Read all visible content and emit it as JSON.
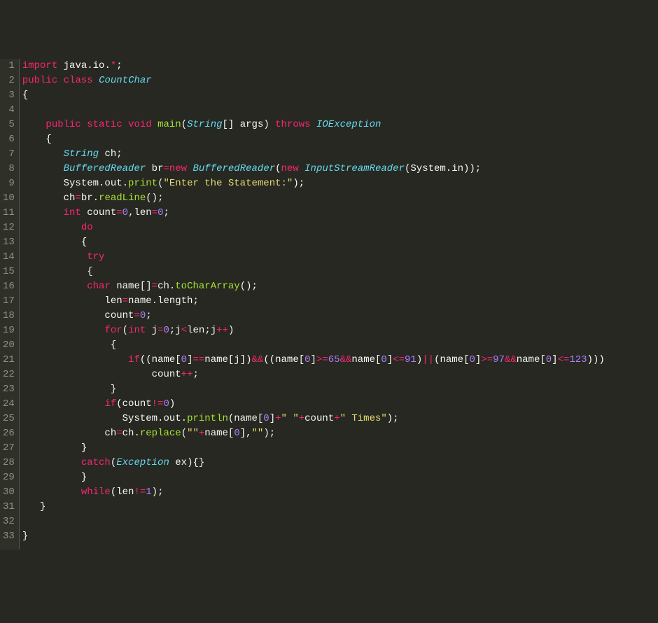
{
  "theme": {
    "background": "#272822",
    "gutter_bg": "#2f3129",
    "gutter_fg": "#8f908a",
    "text": "#f8f8f2",
    "keyword": "#f92672",
    "type": "#66d9ef",
    "function": "#a6e22e",
    "string": "#e6db74",
    "number": "#ae81ff",
    "operator": "#f92672"
  },
  "language": "java",
  "line_count": 33,
  "source_lines": [
    "import java.io.*;",
    "public class CountChar",
    "{",
    "",
    "    public static void main(String[] args) throws IOException",
    "    {",
    "       String ch;",
    "       BufferedReader br=new BufferedReader(new InputStreamReader(System.in));",
    "       System.out.print(\"Enter the Statement:\");",
    "       ch=br.readLine();",
    "       int count=0,len=0;",
    "          do",
    "          {",
    "           try",
    "           {",
    "           char name[]=ch.toCharArray();",
    "              len=name.length;",
    "              count=0;",
    "              for(int j=0;j<len;j++)",
    "               {",
    "                  if((name[0]==name[j])&&((name[0]>=65&&name[0]<=91)||(name[0]>=97&&name[0]<=123)))",
    "                      count++;",
    "               }",
    "              if(count!=0)",
    "                 System.out.println(name[0]+\" \"+count+\" Times\");",
    "              ch=ch.replace(\"\"+name[0],\"\");",
    "          }",
    "          catch(Exception ex){}",
    "          }",
    "          while(len!=1);",
    "   }",
    "",
    "}"
  ],
  "tokens": [
    [
      [
        "kw",
        "import"
      ],
      [
        "plain",
        " java.io."
      ],
      [
        "op",
        "*"
      ],
      [
        "plain",
        ";"
      ]
    ],
    [
      [
        "kw",
        "public"
      ],
      [
        "plain",
        " "
      ],
      [
        "kw",
        "class"
      ],
      [
        "plain",
        " "
      ],
      [
        "type",
        "CountChar"
      ]
    ],
    [
      [
        "plain",
        "{"
      ]
    ],
    [
      [
        "plain",
        ""
      ]
    ],
    [
      [
        "plain",
        "    "
      ],
      [
        "kw",
        "public"
      ],
      [
        "plain",
        " "
      ],
      [
        "kw",
        "static"
      ],
      [
        "plain",
        " "
      ],
      [
        "kw",
        "void"
      ],
      [
        "plain",
        " "
      ],
      [
        "fn",
        "main"
      ],
      [
        "plain",
        "("
      ],
      [
        "type",
        "String"
      ],
      [
        "plain",
        "[] args) "
      ],
      [
        "kw",
        "throws"
      ],
      [
        "plain",
        " "
      ],
      [
        "type",
        "IOException"
      ]
    ],
    [
      [
        "plain",
        "    {"
      ]
    ],
    [
      [
        "plain",
        "       "
      ],
      [
        "type",
        "String"
      ],
      [
        "plain",
        " ch;"
      ]
    ],
    [
      [
        "plain",
        "       "
      ],
      [
        "type",
        "BufferedReader"
      ],
      [
        "plain",
        " br"
      ],
      [
        "op",
        "="
      ],
      [
        "kw",
        "new"
      ],
      [
        "plain",
        " "
      ],
      [
        "type",
        "BufferedReader"
      ],
      [
        "plain",
        "("
      ],
      [
        "kw",
        "new"
      ],
      [
        "plain",
        " "
      ],
      [
        "type",
        "InputStreamReader"
      ],
      [
        "plain",
        "(System.in));"
      ]
    ],
    [
      [
        "plain",
        "       System.out."
      ],
      [
        "fn",
        "print"
      ],
      [
        "plain",
        "("
      ],
      [
        "str",
        "\"Enter the Statement:\""
      ],
      [
        "plain",
        ");"
      ]
    ],
    [
      [
        "plain",
        "       ch"
      ],
      [
        "op",
        "="
      ],
      [
        "plain",
        "br."
      ],
      [
        "fn",
        "readLine"
      ],
      [
        "plain",
        "();"
      ]
    ],
    [
      [
        "plain",
        "       "
      ],
      [
        "kw",
        "int"
      ],
      [
        "plain",
        " count"
      ],
      [
        "op",
        "="
      ],
      [
        "num",
        "0"
      ],
      [
        "plain",
        ",len"
      ],
      [
        "op",
        "="
      ],
      [
        "num",
        "0"
      ],
      [
        "plain",
        ";"
      ]
    ],
    [
      [
        "plain",
        "          "
      ],
      [
        "kw",
        "do"
      ]
    ],
    [
      [
        "plain",
        "          {"
      ]
    ],
    [
      [
        "plain",
        "           "
      ],
      [
        "kw",
        "try"
      ]
    ],
    [
      [
        "plain",
        "           {"
      ]
    ],
    [
      [
        "plain",
        "           "
      ],
      [
        "kw",
        "char"
      ],
      [
        "plain",
        " name[]"
      ],
      [
        "op",
        "="
      ],
      [
        "plain",
        "ch."
      ],
      [
        "fn",
        "toCharArray"
      ],
      [
        "plain",
        "();"
      ]
    ],
    [
      [
        "plain",
        "              len"
      ],
      [
        "op",
        "="
      ],
      [
        "plain",
        "name.length;"
      ]
    ],
    [
      [
        "plain",
        "              count"
      ],
      [
        "op",
        "="
      ],
      [
        "num",
        "0"
      ],
      [
        "plain",
        ";"
      ]
    ],
    [
      [
        "plain",
        "              "
      ],
      [
        "kw",
        "for"
      ],
      [
        "plain",
        "("
      ],
      [
        "kw",
        "int"
      ],
      [
        "plain",
        " j"
      ],
      [
        "op",
        "="
      ],
      [
        "num",
        "0"
      ],
      [
        "plain",
        ";j"
      ],
      [
        "op",
        "<"
      ],
      [
        "plain",
        "len;j"
      ],
      [
        "op",
        "++"
      ],
      [
        "plain",
        ")"
      ]
    ],
    [
      [
        "plain",
        "               {"
      ]
    ],
    [
      [
        "plain",
        "                  "
      ],
      [
        "kw",
        "if"
      ],
      [
        "plain",
        "((name["
      ],
      [
        "num",
        "0"
      ],
      [
        "plain",
        "]"
      ],
      [
        "op",
        "=="
      ],
      [
        "plain",
        "name[j])"
      ],
      [
        "op",
        "&&"
      ],
      [
        "plain",
        "((name["
      ],
      [
        "num",
        "0"
      ],
      [
        "plain",
        "]"
      ],
      [
        "op",
        ">="
      ],
      [
        "num",
        "65"
      ],
      [
        "op",
        "&&"
      ],
      [
        "plain",
        "name["
      ],
      [
        "num",
        "0"
      ],
      [
        "plain",
        "]"
      ],
      [
        "op",
        "<="
      ],
      [
        "num",
        "91"
      ],
      [
        "plain",
        ")"
      ],
      [
        "op",
        "||"
      ],
      [
        "plain",
        "(name["
      ],
      [
        "num",
        "0"
      ],
      [
        "plain",
        "]"
      ],
      [
        "op",
        ">="
      ],
      [
        "num",
        "97"
      ],
      [
        "op",
        "&&"
      ],
      [
        "plain",
        "name["
      ],
      [
        "num",
        "0"
      ],
      [
        "plain",
        "]"
      ],
      [
        "op",
        "<="
      ],
      [
        "num",
        "123"
      ],
      [
        "plain",
        ")))"
      ]
    ],
    [
      [
        "plain",
        "                      count"
      ],
      [
        "op",
        "++"
      ],
      [
        "plain",
        ";"
      ]
    ],
    [
      [
        "plain",
        "               }"
      ]
    ],
    [
      [
        "plain",
        "              "
      ],
      [
        "kw",
        "if"
      ],
      [
        "plain",
        "(count"
      ],
      [
        "op",
        "!="
      ],
      [
        "num",
        "0"
      ],
      [
        "plain",
        ")"
      ]
    ],
    [
      [
        "plain",
        "                 System.out."
      ],
      [
        "fn",
        "println"
      ],
      [
        "plain",
        "(name["
      ],
      [
        "num",
        "0"
      ],
      [
        "plain",
        "]"
      ],
      [
        "op",
        "+"
      ],
      [
        "str",
        "\" \""
      ],
      [
        "op",
        "+"
      ],
      [
        "plain",
        "count"
      ],
      [
        "op",
        "+"
      ],
      [
        "str",
        "\" Times\""
      ],
      [
        "plain",
        ");"
      ]
    ],
    [
      [
        "plain",
        "              ch"
      ],
      [
        "op",
        "="
      ],
      [
        "plain",
        "ch."
      ],
      [
        "fn",
        "replace"
      ],
      [
        "plain",
        "("
      ],
      [
        "str",
        "\"\""
      ],
      [
        "op",
        "+"
      ],
      [
        "plain",
        "name["
      ],
      [
        "num",
        "0"
      ],
      [
        "plain",
        "],"
      ],
      [
        "str",
        "\"\""
      ],
      [
        "plain",
        ");"
      ]
    ],
    [
      [
        "plain",
        "          }"
      ]
    ],
    [
      [
        "plain",
        "          "
      ],
      [
        "kw",
        "catch"
      ],
      [
        "plain",
        "("
      ],
      [
        "type",
        "Exception"
      ],
      [
        "plain",
        " ex){}"
      ]
    ],
    [
      [
        "plain",
        "          }"
      ]
    ],
    [
      [
        "plain",
        "          "
      ],
      [
        "kw",
        "while"
      ],
      [
        "plain",
        "(len"
      ],
      [
        "op",
        "!="
      ],
      [
        "num",
        "1"
      ],
      [
        "plain",
        ");"
      ]
    ],
    [
      [
        "plain",
        "   }"
      ]
    ],
    [
      [
        "plain",
        ""
      ]
    ],
    [
      [
        "plain",
        "}"
      ]
    ]
  ]
}
